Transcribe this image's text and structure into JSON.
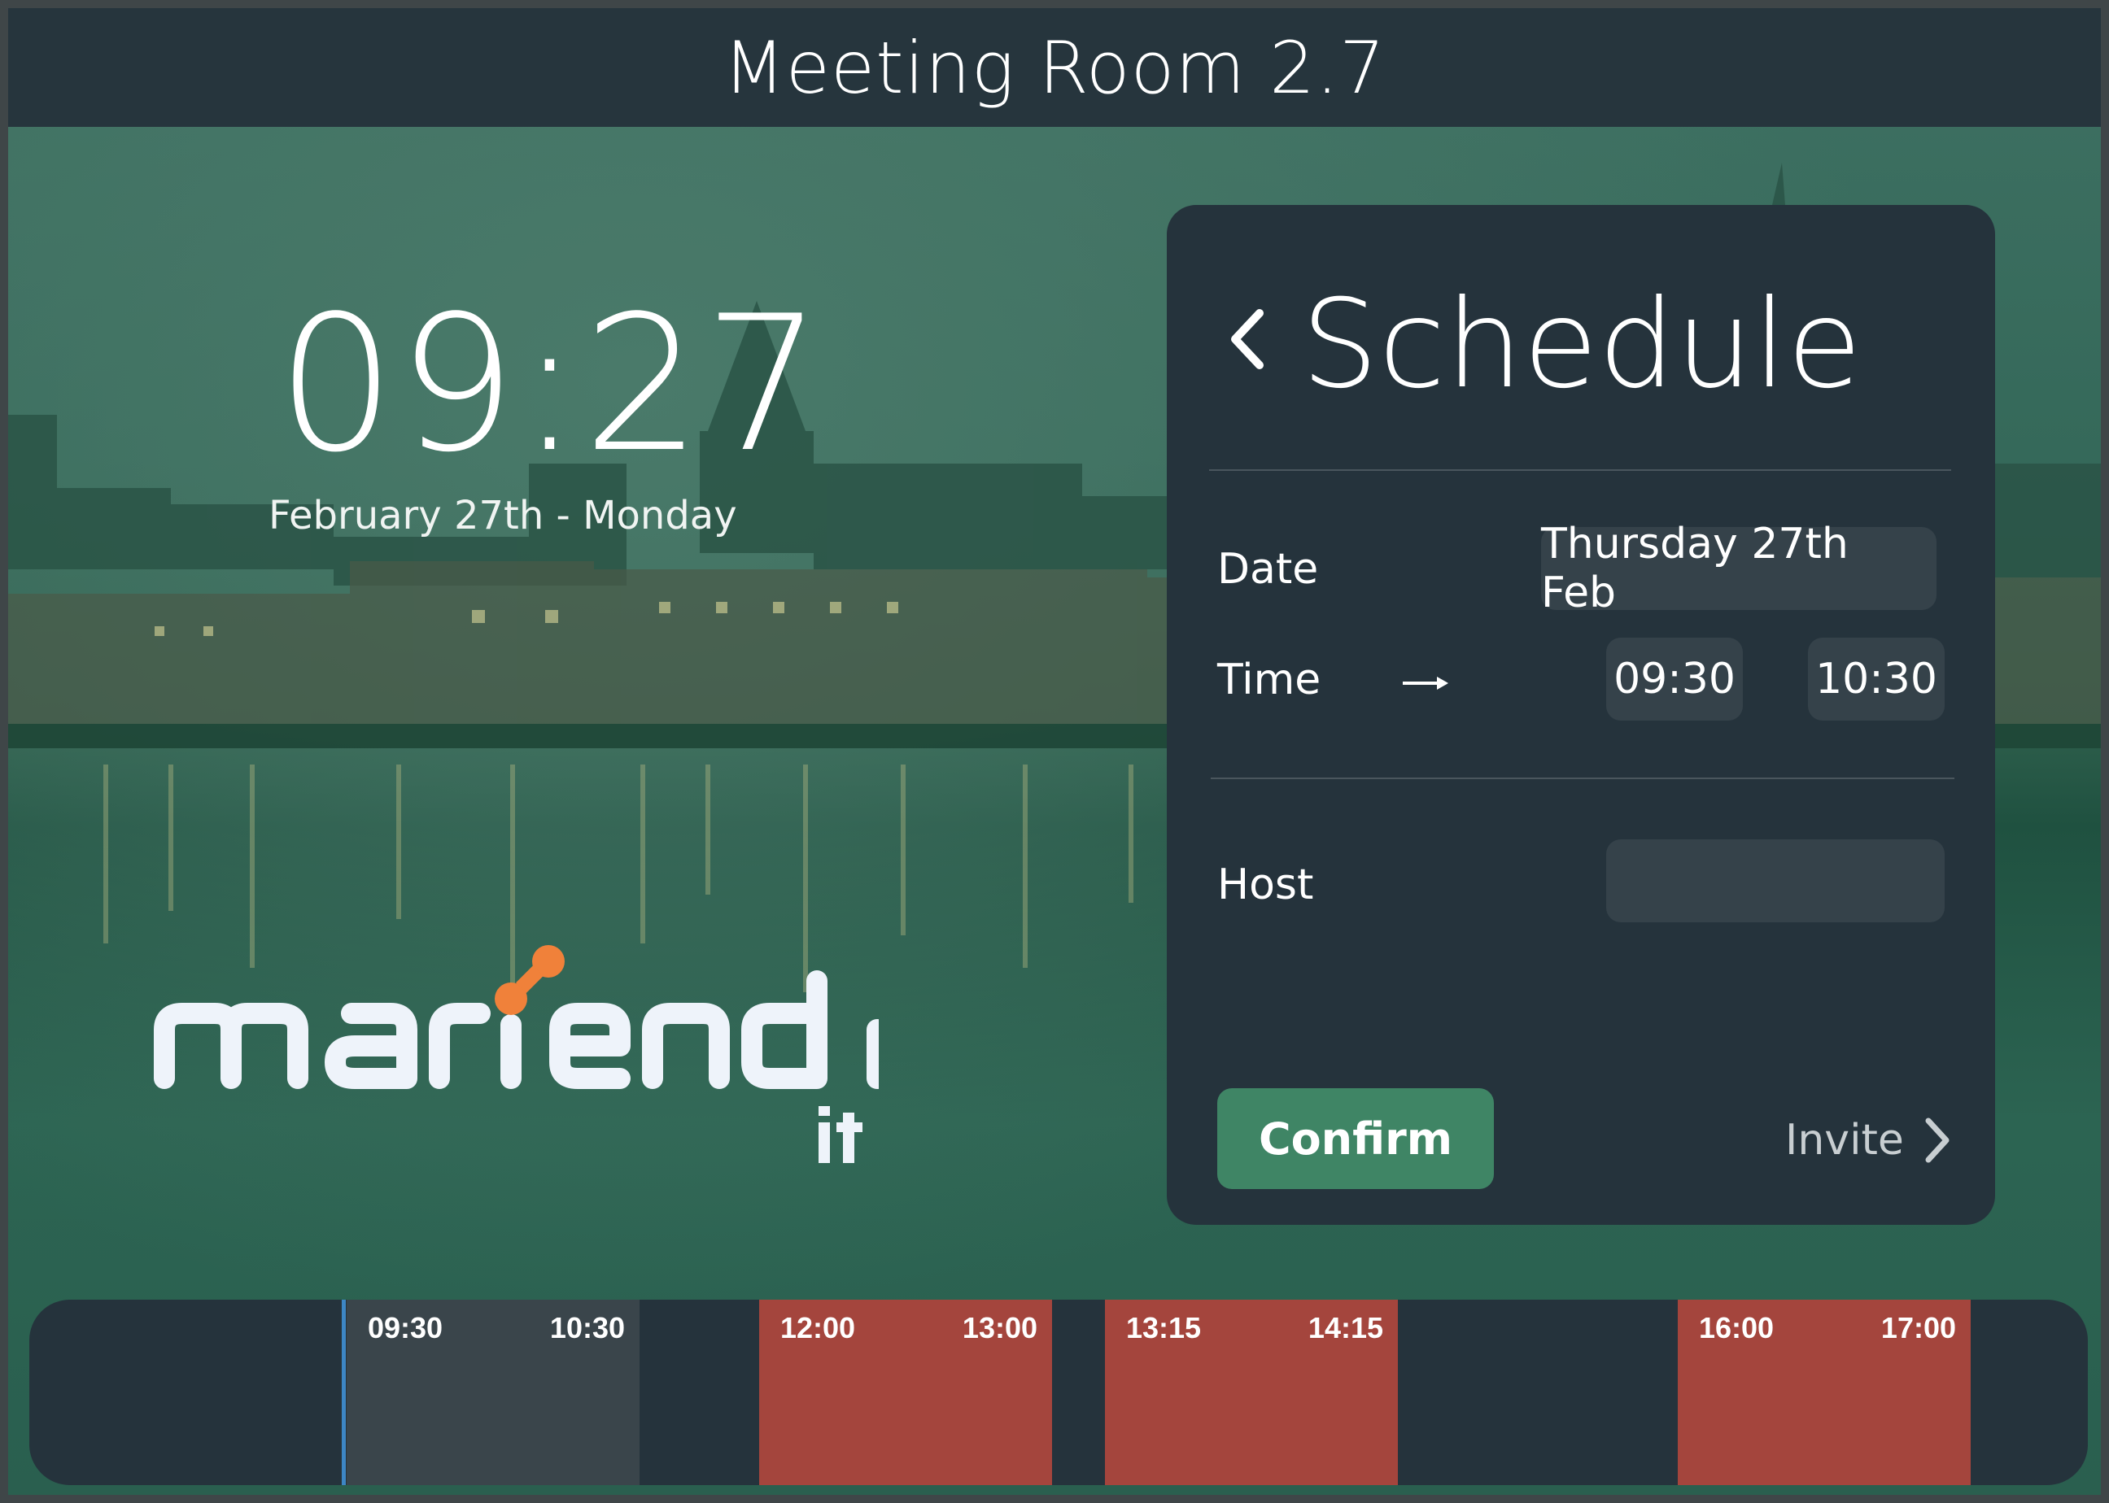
{
  "header": {
    "room_title": "Meeting Room 2.7"
  },
  "clock": {
    "time": "09:27",
    "date": "February 27th - Monday"
  },
  "logo": {
    "name": "mariendal",
    "sub": "it"
  },
  "schedule": {
    "title": "Schedule",
    "date_label": "Date",
    "date_value": "Thursday 27th Feb",
    "time_label": "Time",
    "start_time": "09:30",
    "end_time": "10:30",
    "host_label": "Host",
    "host_value": "",
    "confirm_label": "Confirm",
    "invite_label": "Invite"
  },
  "timeline": {
    "slots": [
      {
        "start": "09:30",
        "end": "10:30",
        "status": "selected",
        "color": "#3a454b"
      },
      {
        "start": "12:00",
        "end": "13:00",
        "status": "booked",
        "color": "#a4453d"
      },
      {
        "start": "13:15",
        "end": "14:15",
        "status": "booked",
        "color": "#a4453d"
      },
      {
        "start": "16:00",
        "end": "17:00",
        "status": "booked",
        "color": "#a4453d"
      }
    ]
  },
  "colors": {
    "header_bg": "#26353d",
    "panel_bg": "#25333c",
    "confirm": "#3f8565",
    "booked": "#a4453d",
    "now_line": "#3d86c4",
    "logo_accent": "#f0813a"
  }
}
